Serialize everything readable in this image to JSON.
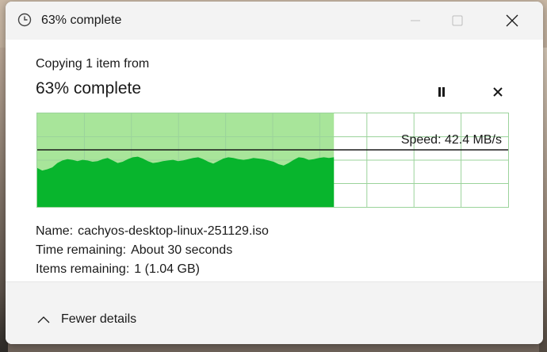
{
  "window": {
    "title": "63% complete",
    "icon": "clock-icon"
  },
  "dialog": {
    "copying_label": "Copying 1 item from",
    "percent_heading": "63% complete",
    "progress_fraction": 0.63,
    "speed_label": "Speed: 42.4 MB/s"
  },
  "details": {
    "name_label": "Name:",
    "name_value": "cachyos-desktop-linux-251129.iso",
    "time_label": "Time remaining:",
    "time_value": "About 30 seconds",
    "items_label": "Items remaining:",
    "items_value": "1 (1.04 GB)"
  },
  "footer": {
    "toggle_label": "Fewer details"
  },
  "colors": {
    "progress_fill": "#a8e59a",
    "speed_area": "#08b52d",
    "grid_line": "#9bd39b"
  },
  "speed_history": [
    0.62,
    0.58,
    0.6,
    0.63,
    0.7,
    0.74,
    0.76,
    0.75,
    0.73,
    0.75,
    0.74,
    0.72,
    0.73,
    0.76,
    0.78,
    0.74,
    0.7,
    0.72,
    0.76,
    0.79,
    0.8,
    0.77,
    0.73,
    0.7,
    0.71,
    0.73,
    0.74,
    0.75,
    0.73,
    0.74,
    0.76,
    0.78,
    0.79,
    0.76,
    0.72,
    0.69,
    0.73,
    0.77,
    0.79,
    0.78,
    0.76,
    0.75,
    0.76,
    0.78,
    0.77,
    0.76,
    0.74,
    0.72,
    0.68,
    0.66,
    0.7,
    0.75,
    0.79,
    0.78,
    0.75,
    0.76,
    0.78,
    0.79,
    0.78,
    0.79
  ]
}
